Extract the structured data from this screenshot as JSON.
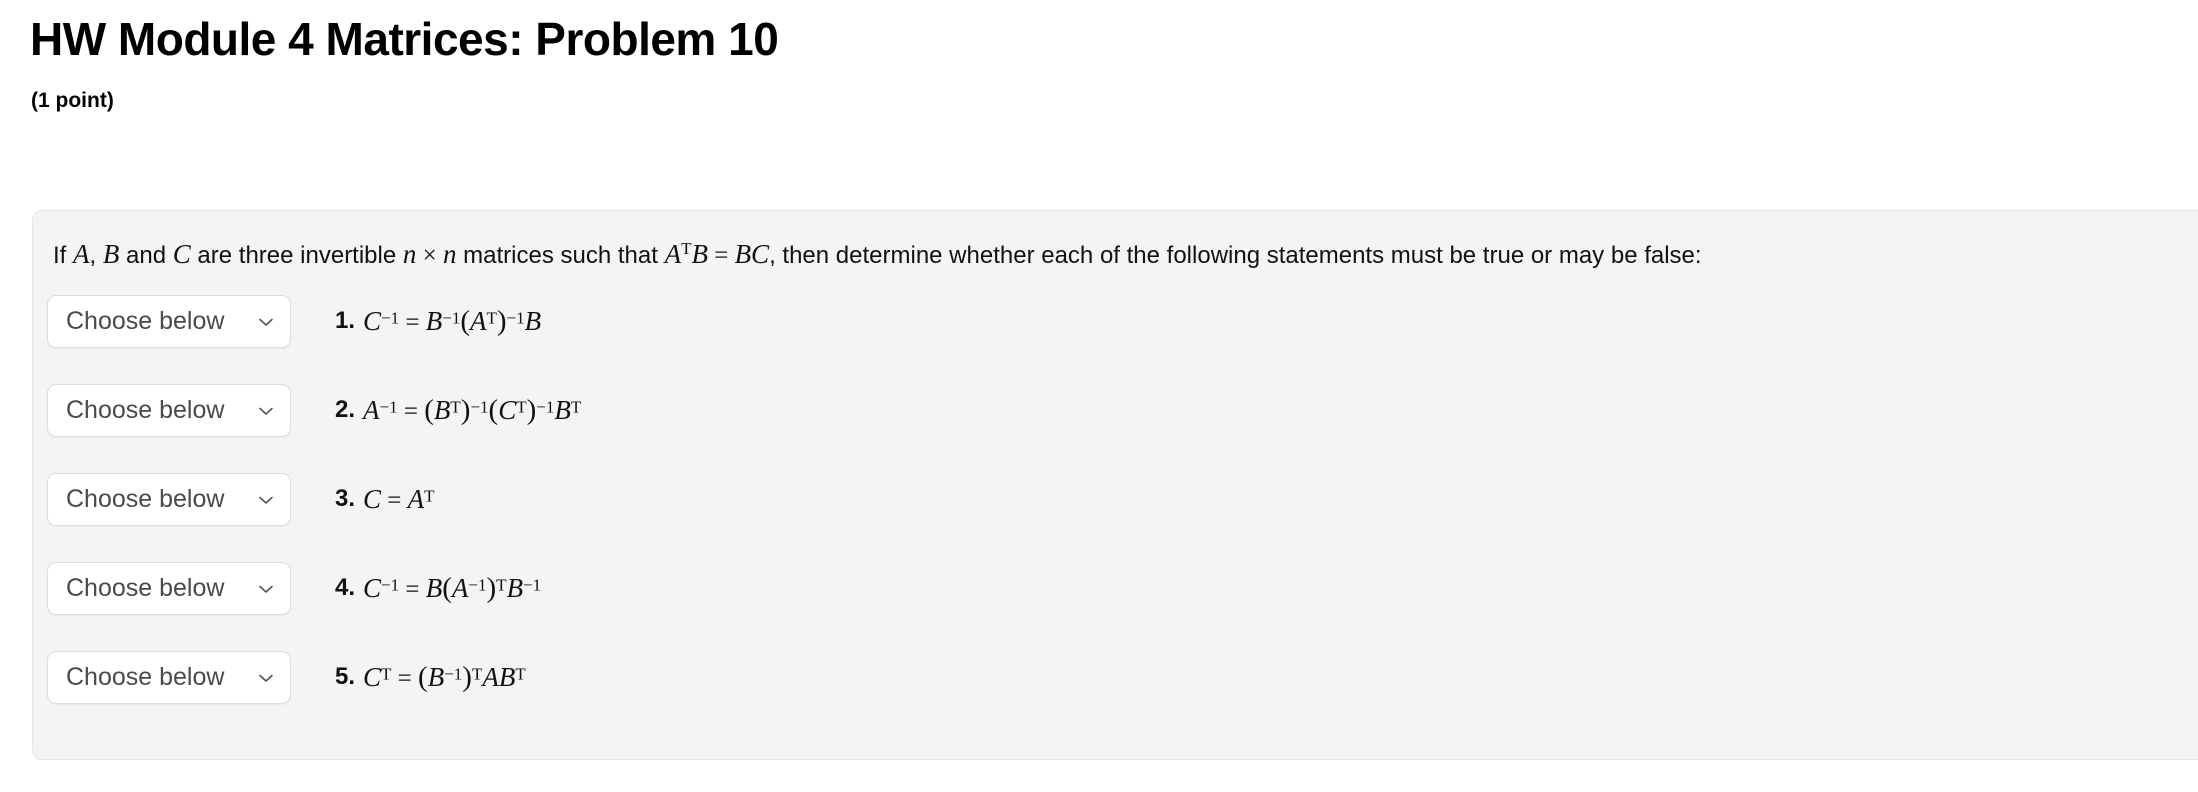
{
  "header": {
    "title": "HW Module 4 Matrices: Problem 10",
    "points": "(1 point)"
  },
  "problem": {
    "statement_text": "If A, B and C are three invertible n × n matrices such that A^T B = BC, then determine whether each of the following statements must be true or may be false:",
    "statement_parts": {
      "lead": "If ",
      "var_a": "A",
      "comma1": ", ",
      "var_b": "B",
      "and": " and ",
      "var_c": "C",
      "mid": " are three invertible ",
      "n1": "n",
      "times": " × ",
      "n2": "n",
      "mid2": " matrices such that ",
      "eq_lhs_a": "A",
      "eq_lhs_a_sup": "T",
      "eq_lhs_b": "B",
      "equals": " = ",
      "eq_rhs": "BC",
      "tail": ", then determine whether each of the following statements must be true or may be false:"
    },
    "select_label": "Choose below",
    "select_icon": "chevron-down-icon",
    "statements": [
      {
        "number": "1.",
        "latex": "C^{-1} = B^{-1}(A^{T})^{-1}B",
        "plain": "C⁻¹ = B⁻¹(Aᵀ)⁻¹B",
        "selected": "Choose below"
      },
      {
        "number": "2.",
        "latex": "A^{-1} = (B^{T})^{-1}(C^{T})^{-1}B^{T}",
        "plain": "A⁻¹ = (Bᵀ)⁻¹(Cᵀ)⁻¹Bᵀ",
        "selected": "Choose below"
      },
      {
        "number": "3.",
        "latex": "C = A^{T}",
        "plain": "C = Aᵀ",
        "selected": "Choose below"
      },
      {
        "number": "4.",
        "latex": "C^{-1} = B(A^{-1})^{T}B^{-1}",
        "plain": "C⁻¹ = B(A⁻¹)ᵀB⁻¹",
        "selected": "Choose below"
      },
      {
        "number": "5.",
        "latex": "C^{T} = (B^{-1})^{T}AB^{T}",
        "plain": "Cᵀ = (B⁻¹)ᵀABᵀ",
        "selected": "Choose below"
      }
    ]
  },
  "colors": {
    "panel_background": "#f4f4f4",
    "panel_border": "#e6e6e6",
    "page_background": "#ffffff",
    "select_background": "#ffffff",
    "select_border": "#dcdcdc",
    "select_text": "#4a4a4a",
    "text": "#111111"
  }
}
